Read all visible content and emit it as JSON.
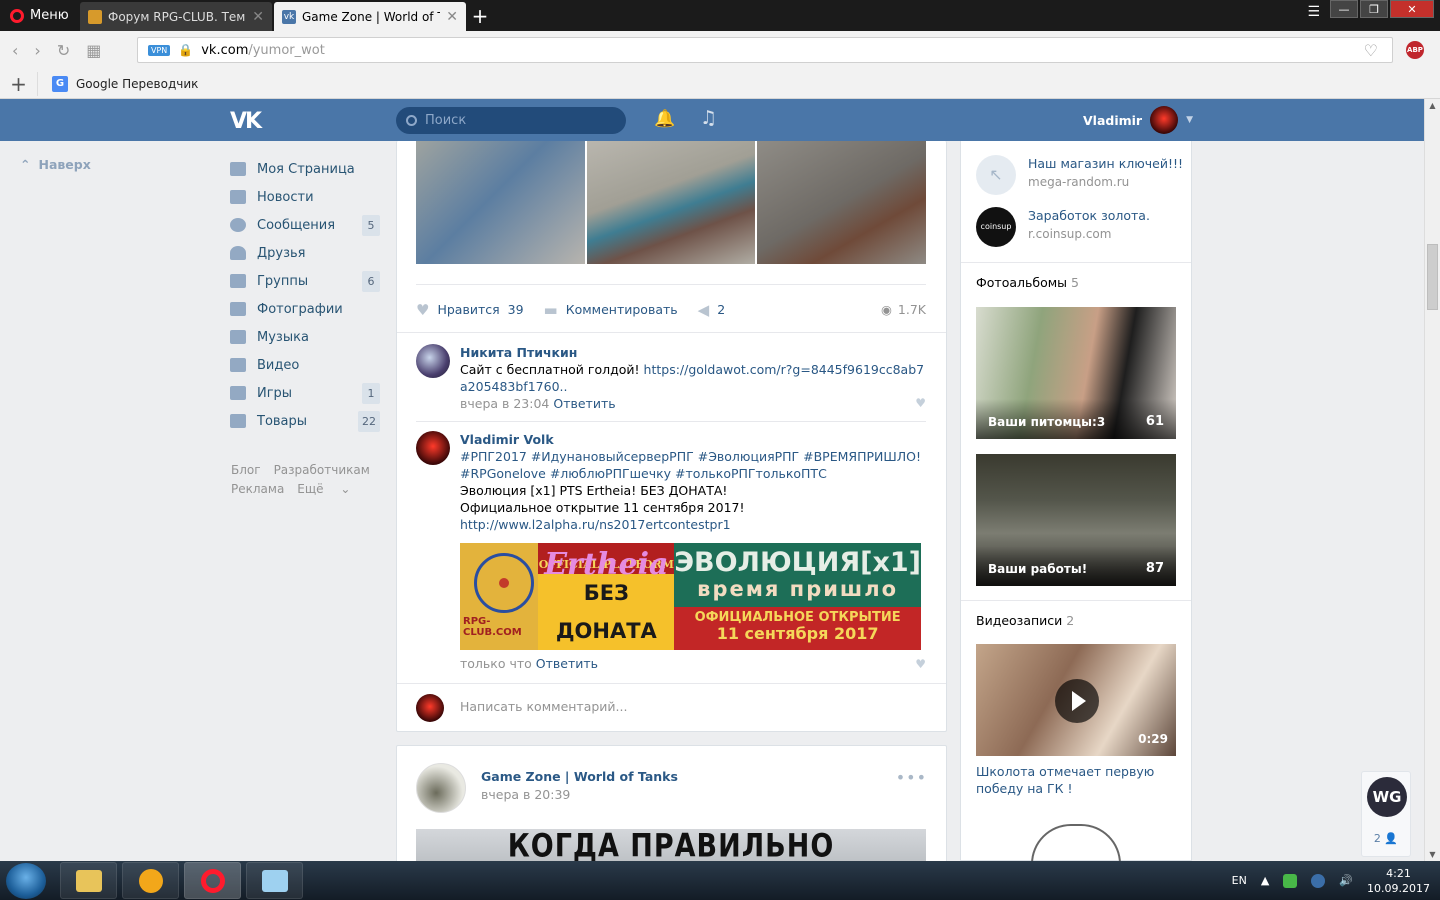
{
  "browser": {
    "menu_label": "Меню",
    "tabs": [
      {
        "title": "Форум RPG-CLUB. Тема: З",
        "active": false
      },
      {
        "title": "Game Zone | World of Tan",
        "active": true
      }
    ],
    "url_host": "vk.com",
    "url_path": "/yumor_wot",
    "vpn_label": "VPN",
    "abp_label": "ABP",
    "bookmarks": [
      {
        "label": "Google Переводчик"
      }
    ]
  },
  "vk_header": {
    "search_placeholder": "Поиск",
    "user_name": "Vladimir"
  },
  "left_nav": {
    "scroll_up": "Наверх",
    "items": [
      {
        "label": "Моя Страница",
        "count": ""
      },
      {
        "label": "Новости",
        "count": ""
      },
      {
        "label": "Сообщения",
        "count": "5"
      },
      {
        "label": "Друзья",
        "count": ""
      },
      {
        "label": "Группы",
        "count": "6"
      },
      {
        "label": "Фотографии",
        "count": ""
      },
      {
        "label": "Музыка",
        "count": ""
      },
      {
        "label": "Видео",
        "count": ""
      },
      {
        "label": "Игры",
        "count": "1"
      },
      {
        "label": "Товары",
        "count": "22"
      }
    ],
    "footer": {
      "blog": "Блог",
      "developers": "Разработчикам",
      "ads": "Реклама",
      "more": "Ещё"
    }
  },
  "post1": {
    "like_label": "Нравится",
    "like_count": "39",
    "comment_label": "Комментировать",
    "share_count": "2",
    "views": "1.7K",
    "comments": [
      {
        "author": "Никита Птичкин",
        "text": "Сайт с бесплатной голдой!",
        "link": "https://goldawot.com/r?g=8445f9619cc8ab7a205483bf1760..",
        "time": "вчера в 23:04",
        "reply": "Ответить"
      },
      {
        "author": "Vladimir Volk",
        "hashtags1": "#РПГ2017 #ИдунановыйсерверРПГ #ЭволюцияРПГ #ВРЕМЯПРИШЛО!",
        "hashtags2": "#RPGonelove #люблюРПГшечку #толькоРПГтолькоПТС",
        "line1": "Эволюция [x1] PTS Ertheia! БЕЗ ДОНАТА!",
        "line2": "Официальное открытие 11 сентября 2017!",
        "link": "http://www.l2alpha.ru/ns2017ertcontestpr1",
        "time": "только что",
        "reply": "Ответить"
      }
    ],
    "banner": {
      "club": "RPG-CLUB.COM",
      "script": "Ertheia",
      "official": "OFFICIAL PLATFORM",
      "no_donate": "БЕЗ ДОНАТА",
      "evolution": "ЭВОЛЮЦИЯ[x1]",
      "time_come": "время пришло",
      "opening": "ОФИЦИАЛЬНОЕ ОТКРЫТИЕ",
      "date": "11 сентября 2017"
    },
    "write_placeholder": "Написать комментарий..."
  },
  "post2": {
    "group_name": "Game Zone | World of Tanks",
    "date": "вчера в 20:39",
    "image_caption": "КОГДА ПРАВИЛЬНО"
  },
  "right": {
    "links": [
      {
        "title": "Наш магазин ключей!!!",
        "url": "mega-random.ru"
      },
      {
        "title": "Заработок золота.",
        "url": "r.coinsup.com"
      }
    ],
    "albums_label": "Фотоальбомы",
    "albums_count": "5",
    "albums": [
      {
        "title": "Ваши питомцы:3",
        "count": "61"
      },
      {
        "title": "Ваши работы!",
        "count": "87"
      }
    ],
    "videos_label": "Видеозаписи",
    "videos_count": "2",
    "video": {
      "duration": "0:29",
      "title": "Школота отмечает первую победу на ГК !"
    }
  },
  "widget": {
    "logo": "WG",
    "members": "2"
  },
  "taskbar": {
    "lang": "EN",
    "time": "4:21",
    "date": "10.09.2017"
  }
}
